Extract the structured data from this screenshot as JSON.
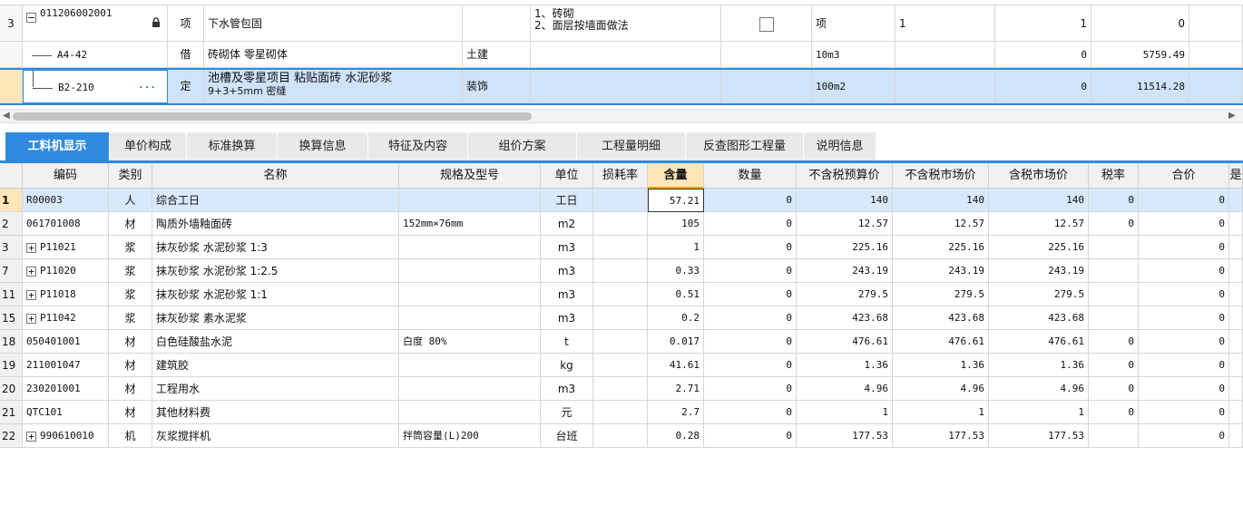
{
  "top_rows": [
    {
      "num": "3",
      "code": "011206002001",
      "type": "项",
      "name": "下水管包固",
      "prof": "",
      "feature": [
        "1、砖砌",
        "2、面层按墙面做法"
      ],
      "unit": "项",
      "expr": "1",
      "qty": "1",
      "price": "0"
    },
    {
      "num": "",
      "code": "A4-42",
      "type": "借",
      "name": "砖砌体 零星砌体",
      "prof": "土建",
      "feature": [],
      "unit": "10m3",
      "expr": "",
      "qty": "0",
      "price": "5759.49"
    },
    {
      "num": "",
      "code": "B2-210",
      "type": "定",
      "name": "池槽及零星项目 粘贴面砖 水泥砂浆",
      "name2": "9+3+5mm 密缝",
      "prof": "装饰",
      "feature": [],
      "unit": "100m2",
      "expr": "",
      "qty": "0",
      "price": "11514.28"
    }
  ],
  "more_icon": "···",
  "tabs": [
    "工料机显示",
    "单价构成",
    "标准换算",
    "换算信息",
    "特征及内容",
    "组价方案",
    "工程量明细",
    "反查图形工程量",
    "说明信息"
  ],
  "columns": [
    "编码",
    "类别",
    "名称",
    "规格及型号",
    "单位",
    "损耗率",
    "含量",
    "数量",
    "不含税预算价",
    "不含税市场价",
    "含税市场价",
    "税率",
    "合价",
    "是"
  ],
  "rows": [
    {
      "n": "1",
      "code": "R00003",
      "cat": "人",
      "name": "综合工日",
      "spec": "",
      "unit": "工日",
      "loss": "",
      "content": "57.21",
      "qty": "0",
      "p1": "140",
      "p2": "140",
      "p3": "140",
      "tax": "0",
      "total": "0",
      "exp": false
    },
    {
      "n": "2",
      "code": "061701008",
      "cat": "材",
      "name": "陶质外墙釉面砖",
      "spec": "152mm×76mm",
      "unit": "m2",
      "loss": "",
      "content": "105",
      "qty": "0",
      "p1": "12.57",
      "p2": "12.57",
      "p3": "12.57",
      "tax": "0",
      "total": "0",
      "exp": false
    },
    {
      "n": "3",
      "code": "P11021",
      "cat": "浆",
      "name": "抹灰砂浆 水泥砂浆 1:3",
      "spec": "",
      "unit": "m3",
      "loss": "",
      "content": "1",
      "qty": "0",
      "p1": "225.16",
      "p2": "225.16",
      "p3": "225.16",
      "tax": "",
      "total": "0",
      "exp": true
    },
    {
      "n": "7",
      "code": "P11020",
      "cat": "浆",
      "name": "抹灰砂浆 水泥砂浆 1:2.5",
      "spec": "",
      "unit": "m3",
      "loss": "",
      "content": "0.33",
      "qty": "0",
      "p1": "243.19",
      "p2": "243.19",
      "p3": "243.19",
      "tax": "",
      "total": "0",
      "exp": true
    },
    {
      "n": "11",
      "code": "P11018",
      "cat": "浆",
      "name": "抹灰砂浆 水泥砂浆 1:1",
      "spec": "",
      "unit": "m3",
      "loss": "",
      "content": "0.51",
      "qty": "0",
      "p1": "279.5",
      "p2": "279.5",
      "p3": "279.5",
      "tax": "",
      "total": "0",
      "exp": true
    },
    {
      "n": "15",
      "code": "P11042",
      "cat": "浆",
      "name": "抹灰砂浆 素水泥浆",
      "spec": "",
      "unit": "m3",
      "loss": "",
      "content": "0.2",
      "qty": "0",
      "p1": "423.68",
      "p2": "423.68",
      "p3": "423.68",
      "tax": "",
      "total": "0",
      "exp": true
    },
    {
      "n": "18",
      "code": "050401001",
      "cat": "材",
      "name": "白色硅酸盐水泥",
      "spec": "白度 80%",
      "unit": "t",
      "loss": "",
      "content": "0.017",
      "qty": "0",
      "p1": "476.61",
      "p2": "476.61",
      "p3": "476.61",
      "tax": "0",
      "total": "0",
      "exp": false
    },
    {
      "n": "19",
      "code": "211001047",
      "cat": "材",
      "name": "建筑胶",
      "spec": "",
      "unit": "kg",
      "loss": "",
      "content": "41.61",
      "qty": "0",
      "p1": "1.36",
      "p2": "1.36",
      "p3": "1.36",
      "tax": "0",
      "total": "0",
      "exp": false
    },
    {
      "n": "20",
      "code": "230201001",
      "cat": "材",
      "name": "工程用水",
      "spec": "",
      "unit": "m3",
      "loss": "",
      "content": "2.71",
      "qty": "0",
      "p1": "4.96",
      "p2": "4.96",
      "p3": "4.96",
      "tax": "0",
      "total": "0",
      "exp": false
    },
    {
      "n": "21",
      "code": "QTC101",
      "cat": "材",
      "name": "其他材料费",
      "spec": "",
      "unit": "元",
      "loss": "",
      "content": "2.7",
      "qty": "0",
      "p1": "1",
      "p2": "1",
      "p3": "1",
      "tax": "0",
      "total": "0",
      "exp": false
    },
    {
      "n": "22",
      "code": "990610010",
      "cat": "机",
      "name": "灰浆搅拌机",
      "spec": "拌筒容量(L)200",
      "unit": "台班",
      "loss": "",
      "content": "0.28",
      "qty": "0",
      "p1": "177.53",
      "p2": "177.53",
      "p3": "177.53",
      "tax": "",
      "total": "0",
      "exp": true
    }
  ],
  "expand_glyph": "+",
  "collapse_glyph": "−",
  "accent": "#2f8ae0"
}
